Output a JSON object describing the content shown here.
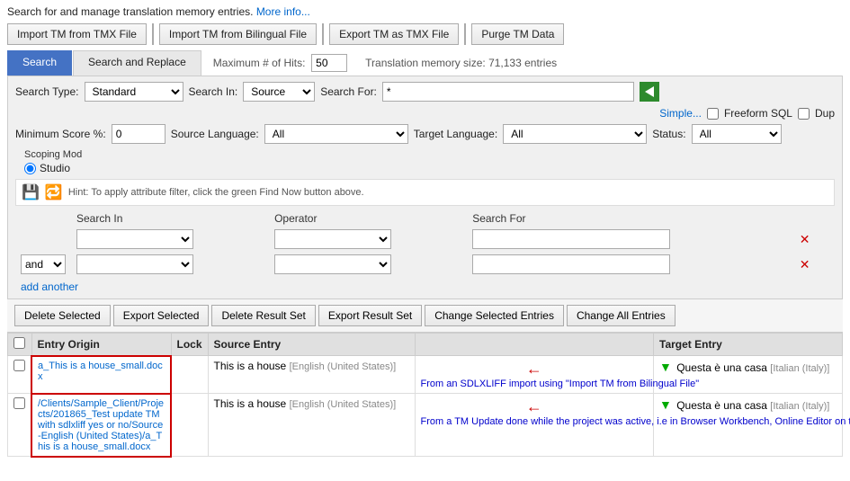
{
  "topInfo": {
    "text": "Search for and manage translation memory entries.",
    "link": "More info..."
  },
  "buttons": {
    "importTMX": "Import TM from TMX File",
    "importBilingual": "Import TM from Bilingual File",
    "exportTMX": "Export TM as TMX File",
    "purge": "Purge TM Data"
  },
  "tabs": {
    "search": "Search",
    "searchReplace": "Search and Replace",
    "maxHitsLabel": "Maximum # of Hits:",
    "maxHitsValue": "50",
    "tmSizeText": "Translation memory size: 71,133 entries"
  },
  "searchPanel": {
    "searchTypeLabel": "Search Type:",
    "searchTypeValue": "Standard",
    "searchInLabel": "Search In:",
    "searchInValue": "Source",
    "searchForLabel": "Search For:",
    "searchForValue": "*",
    "simpleLink": "Simple...",
    "freeformLabel": "Freeform SQL",
    "dupLabel": "Dup",
    "minScoreLabel": "Minimum Score %:",
    "minScoreValue": "0",
    "sourceLangLabel": "Source Language:",
    "sourceLangValue": "All",
    "targetLangLabel": "Target Language:",
    "targetLangValue": "All",
    "statusLabel": "Status:",
    "statusValue": "All",
    "scopingLabel": "Scoping Mod",
    "scopingOption1": "Studio",
    "hintText": "Hint: To apply attribute filter, click the green Find Now button above."
  },
  "filterTable": {
    "col1": "Search In",
    "col2": "Operator",
    "col3": "Search For",
    "row1": {
      "searchIn": "",
      "operator": "",
      "searchFor": ""
    },
    "row2": {
      "connector": "and",
      "searchIn": "",
      "operator": "",
      "searchFor": ""
    },
    "addAnother": "add another"
  },
  "actionBar": {
    "deleteSelected": "Delete Selected",
    "exportSelected": "Export Selected",
    "deleteResultSet": "Delete Result Set",
    "exportResultSet": "Export Result Set",
    "changeSelected": "Change Selected Entries",
    "changeAll": "Change All Entries"
  },
  "tableHeaders": {
    "checkbox": "",
    "entryOrigin": "Entry Origin",
    "lock": "Lock",
    "sourceEntry": "Source Entry",
    "targetEntry": "Target Entry"
  },
  "tableRows": [
    {
      "id": "row1",
      "checked": false,
      "entryOrigin": "a_This is a house_small.docx",
      "lock": "",
      "sourceText": "This is a house",
      "sourceLang": "[English (United States)]",
      "targetSymbol": "▼",
      "targetText": "Questa è una casa",
      "targetLang": "[Italian (Italy)]",
      "annotation": "From an SDLXLIFF import using \"Import TM from Bilingual File\"",
      "highlight": false
    },
    {
      "id": "row2",
      "checked": false,
      "entryOrigin": "/Clients/Sample_Client/Projects/201865_Test update TM with sdlxliff yes or no/Source-English (United States)/a_This is a house_small.docx",
      "lock": "",
      "sourceText": "This is a house",
      "sourceLang": "[English (United States)]",
      "targetSymbol": "▼",
      "targetText": "Questa è una casa",
      "targetLang": "[Italian (Italy)]",
      "annotation": "From a TM Update done while the project was active, i.e in Browser Workbench, Online Editor on through an import of a Return package",
      "highlight": false
    }
  ]
}
